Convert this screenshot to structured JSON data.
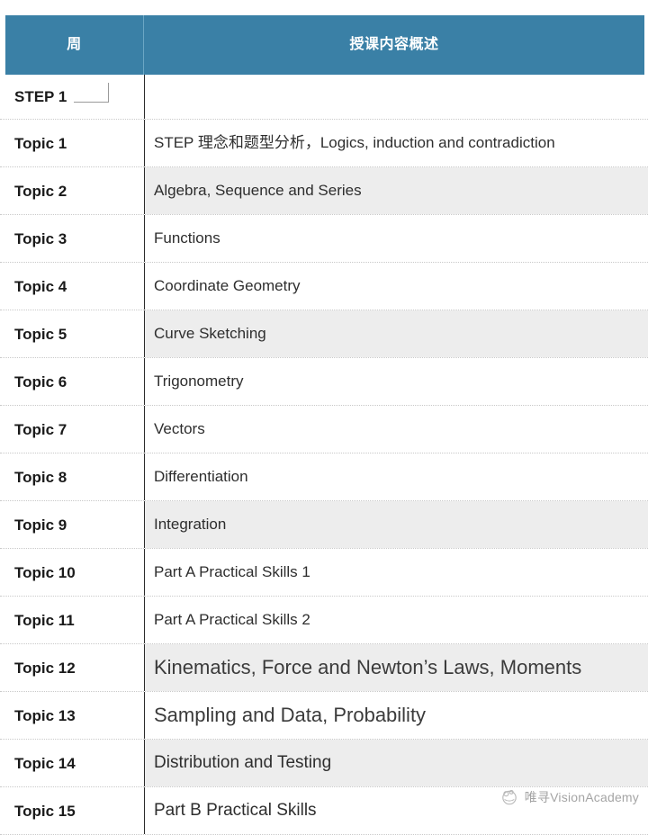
{
  "table": {
    "headers": {
      "week": "周",
      "content": "授课内容概述"
    },
    "section_label": "STEP 1",
    "rows": [
      {
        "week": "Topic 1",
        "content": "STEP 理念和题型分析，Logics, induction and contradiction",
        "shaded": false,
        "size": "sm"
      },
      {
        "week": "Topic 2",
        "content": "Algebra, Sequence and Series",
        "shaded": true,
        "size": "sm"
      },
      {
        "week": "Topic 3",
        "content": "Functions",
        "shaded": false,
        "size": "sm"
      },
      {
        "week": "Topic 4",
        "content": "Coordinate Geometry",
        "shaded": false,
        "size": "sm"
      },
      {
        "week": "Topic 5",
        "content": "Curve Sketching",
        "shaded": true,
        "size": "sm"
      },
      {
        "week": "Topic 6",
        "content": "Trigonometry",
        "shaded": false,
        "size": "sm"
      },
      {
        "week": "Topic 7",
        "content": "Vectors",
        "shaded": false,
        "size": "sm"
      },
      {
        "week": "Topic 8",
        "content": "Differentiation",
        "shaded": false,
        "size": "sm"
      },
      {
        "week": "Topic 9",
        "content": "Integration",
        "shaded": true,
        "size": "sm"
      },
      {
        "week": "Topic 10",
        "content": "Part A Practical Skills 1",
        "shaded": false,
        "size": "sm"
      },
      {
        "week": "Topic 11",
        "content": "Part A Practical Skills 2",
        "shaded": false,
        "size": "sm"
      },
      {
        "week": "Topic 12",
        "content": "Kinematics, Force and Newton’s Laws, Moments",
        "shaded": true,
        "size": "lg"
      },
      {
        "week": "Topic 13",
        "content": "Sampling and Data, Probability",
        "shaded": false,
        "size": "lg"
      },
      {
        "week": "Topic 14",
        "content": "Distribution and Testing",
        "shaded": true,
        "size": "md"
      },
      {
        "week": "Topic 15",
        "content": "Part B Practical Skills",
        "shaded": false,
        "size": "md"
      }
    ]
  },
  "watermark": {
    "text": "唯寻VisionAcademy",
    "icon": "vision-academy-logo-icon"
  },
  "colors": {
    "header_blue": "#3a80a6",
    "header_text": "#ffffff",
    "row_shade": "#ededed",
    "row_divider": "#c9c9c9",
    "column_divider": "#2b2b2b",
    "body_text": "#2e2e2e"
  }
}
